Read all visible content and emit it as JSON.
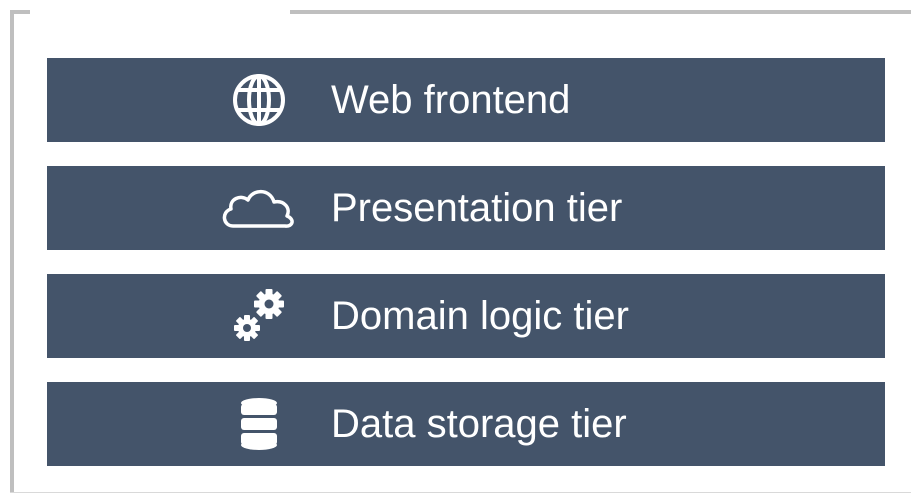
{
  "tiers": [
    {
      "label": "Web frontend",
      "icon": "globe-icon"
    },
    {
      "label": "Presentation tier",
      "icon": "cloud-icon"
    },
    {
      "label": "Domain logic tier",
      "icon": "gears-icon"
    },
    {
      "label": "Data storage tier",
      "icon": "database-icon"
    }
  ],
  "colors": {
    "tier_fill": "#44546a",
    "text": "#ffffff",
    "frame": "#bfbfbf"
  }
}
